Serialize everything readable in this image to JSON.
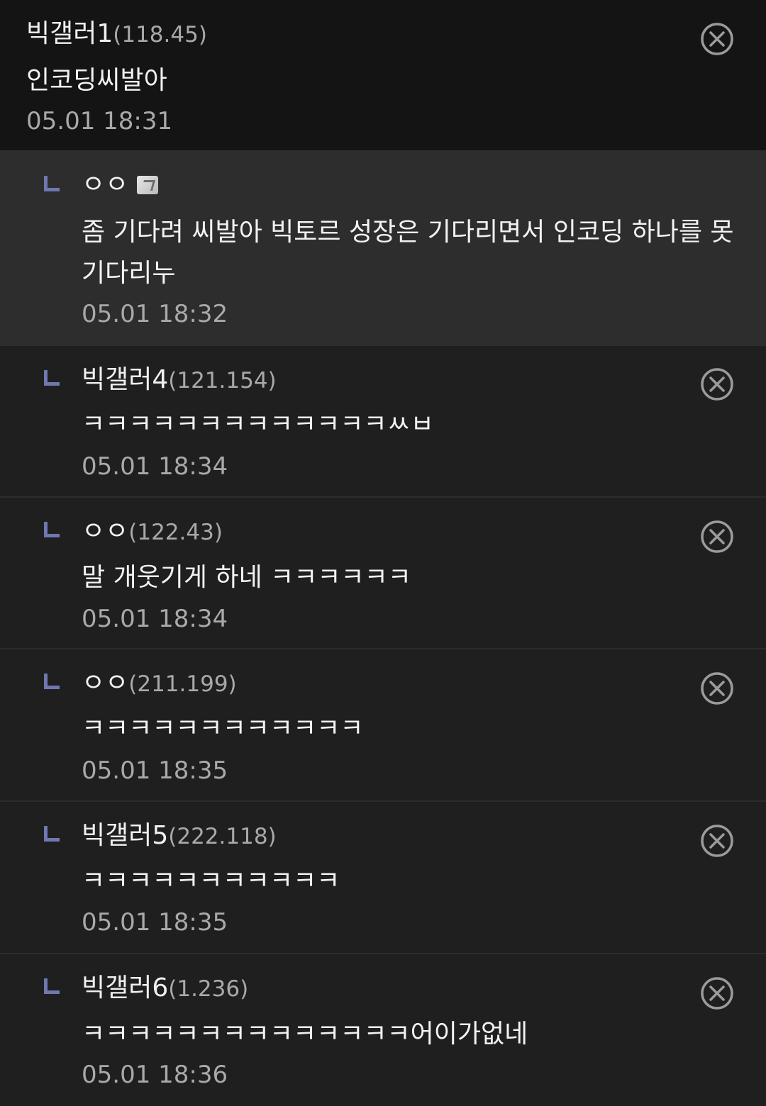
{
  "comments": [
    {
      "author": "빅갤러1",
      "ip": "(118.45)",
      "text": "인코딩씨발아",
      "time": "05.01 18:31",
      "is_reply": false,
      "deletable": true
    },
    {
      "author": "ㅇㅇ",
      "ip": "",
      "text": "좀 기다려 씨발아 빅토르 성장은 기다리면서 인코딩 하나를 못 기다리누",
      "time": "05.01 18:32",
      "is_reply": true,
      "deletable": false,
      "badge_icon": "gallery-badge-icon"
    },
    {
      "author": "빅갤러4",
      "ip": "(121.154)",
      "text": "ㅋㅋㅋㅋㅋㅋㅋㅋㅋㅋㅋㅋㅋㅆㅂ",
      "time": "05.01 18:34",
      "is_reply": true,
      "deletable": true
    },
    {
      "author": "ㅇㅇ",
      "ip": "(122.43)",
      "text": "말 개웃기게 하네 ㅋㅋㅋㅋㅋㅋ",
      "time": "05.01 18:34",
      "is_reply": true,
      "deletable": true
    },
    {
      "author": "ㅇㅇ",
      "ip": "(211.199)",
      "text": "ㅋㅋㅋㅋㅋㅋㅋㅋㅋㅋㅋㅋ",
      "time": "05.01 18:35",
      "is_reply": true,
      "deletable": true
    },
    {
      "author": "빅갤러5",
      "ip": "(222.118)",
      "text": "ㅋㅋㅋㅋㅋㅋㅋㅋㅋㅋㅋ",
      "time": "05.01 18:35",
      "is_reply": true,
      "deletable": true
    },
    {
      "author": "빅갤러6",
      "ip": "(1.236)",
      "text": "ㅋㅋㅋㅋㅋㅋㅋㅋㅋㅋㅋㅋㅋㅋ어이가없네",
      "time": "05.01 18:36",
      "is_reply": true,
      "deletable": true
    }
  ],
  "icons": {
    "delete": "close-circle-icon",
    "reply": "reply-arrow-icon"
  },
  "colors": {
    "background": "#1f1f1f",
    "parent_background": "#141414",
    "highlight_background": "#2d2d2d",
    "reply_marker": "#6f78b0",
    "text": "#f2f2f2",
    "muted_text": "#a9a9a9"
  }
}
